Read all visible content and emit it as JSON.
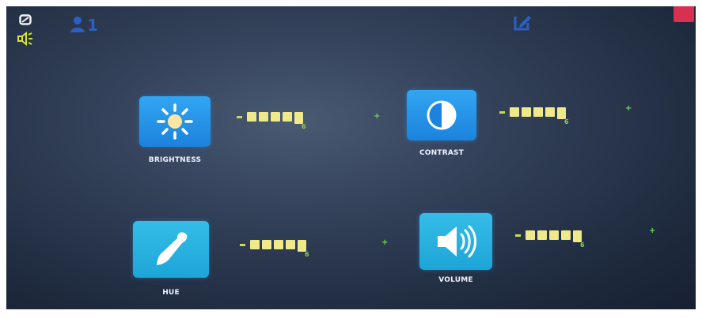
{
  "status_bar": {
    "input_icon": "input-source-icon",
    "speaker_icon": "speaker-icon",
    "mode_text": "1",
    "edit_icon": "edit-icon",
    "corner_indicator_color": "#d83050"
  },
  "colors": {
    "tile_blue": "#1c82dc",
    "tile_cyan": "#1ea5d8",
    "level_block": "#f0e98a",
    "level_value": "#8fd04c",
    "plus_sign": "#6fdc5a"
  },
  "controls": [
    {
      "id": "brightness",
      "label": "BRIGHTNESS",
      "icon": "sun-icon",
      "value": "6",
      "minus": "-",
      "plus": "+"
    },
    {
      "id": "contrast",
      "label": "CONTRAST",
      "icon": "contrast-icon",
      "value": "6",
      "minus": "-",
      "plus": "+"
    },
    {
      "id": "hue",
      "label": "HUE",
      "icon": "eyedropper-icon",
      "value": "6",
      "minus": "-",
      "plus": "+"
    },
    {
      "id": "volume",
      "label": "VOLUME",
      "icon": "speaker-icon",
      "value": "6",
      "minus": "-",
      "plus": "+"
    }
  ]
}
